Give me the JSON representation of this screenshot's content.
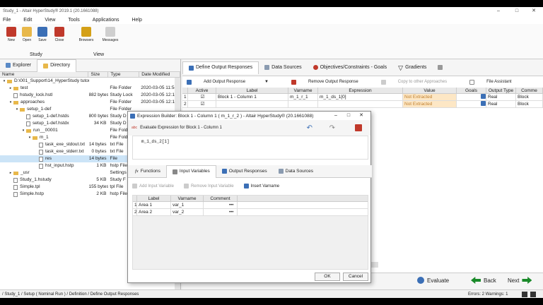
{
  "window": {
    "title": "Study_1 - Altair HyperStudy® 2019.1 (20.1661088)",
    "min": "–",
    "max": "□",
    "close": "✕"
  },
  "menu": [
    "File",
    "Edit",
    "View",
    "Tools",
    "Applications",
    "Help"
  ],
  "ribbon": {
    "study_buttons": [
      "New",
      "Open",
      "Save",
      "Close"
    ],
    "study_group": "Study",
    "view_buttons": [
      "Browsers",
      "Messages"
    ],
    "view_group": "View"
  },
  "left_tabs": [
    "Explorer",
    "Directory"
  ],
  "tree_columns": [
    "Name",
    "Size",
    "Type",
    "Date Modified"
  ],
  "tree": [
    {
      "name": "D:\\001_Support\\14_HyperStudy tutorials_recording\\HS-1010_Set Up a Simple Stu...",
      "size": "",
      "type": "",
      "date": "",
      "kind": "folder",
      "indent": 0,
      "arrow": "▾"
    },
    {
      "name": "test",
      "size": "",
      "type": "File Folder",
      "date": "2020-03-05 11:54",
      "kind": "folder",
      "indent": 1,
      "arrow": "▸"
    },
    {
      "name": "hstudy_lock.hstl",
      "size": "882 bytes",
      "type": "Study Lock",
      "date": "2020-03-05 12:14",
      "kind": "file",
      "indent": 1,
      "arrow": ""
    },
    {
      "name": "approaches",
      "size": "",
      "type": "File Folder",
      "date": "2020-03-05 12:11",
      "kind": "folder",
      "indent": 1,
      "arrow": "▾"
    },
    {
      "name": "setup_1-def",
      "size": "",
      "type": "File Folder",
      "date": "",
      "kind": "folder",
      "indent": 2,
      "arrow": "▾"
    },
    {
      "name": "setup_1-def.hstds",
      "size": "800 bytes",
      "type": "Study D",
      "date": "",
      "kind": "file",
      "indent": 3,
      "arrow": ""
    },
    {
      "name": "setup_1-def.hstdx",
      "size": "34 KB",
      "type": "Study D",
      "date": "",
      "kind": "file",
      "indent": 3,
      "arrow": ""
    },
    {
      "name": "run__00001",
      "size": "",
      "type": "File Fold",
      "date": "",
      "kind": "folder",
      "indent": 3,
      "arrow": "▾"
    },
    {
      "name": "m_1",
      "size": "",
      "type": "File Fold",
      "date": "",
      "kind": "folder",
      "indent": 4,
      "arrow": "▾"
    },
    {
      "name": "task_exe_stdout.txt",
      "size": "14 bytes",
      "type": "txt File",
      "date": "",
      "kind": "file",
      "indent": 5,
      "arrow": ""
    },
    {
      "name": "task_exe_stderr.txt",
      "size": "0 bytes",
      "type": "txt File",
      "date": "",
      "kind": "file",
      "indent": 5,
      "arrow": ""
    },
    {
      "name": "res",
      "size": "14 bytes",
      "type": "File",
      "date": "",
      "kind": "file",
      "indent": 5,
      "arrow": "",
      "selected": true
    },
    {
      "name": "hst_input.hstp",
      "size": "1 KB",
      "type": "hstp File",
      "date": "",
      "kind": "file",
      "indent": 5,
      "arrow": ""
    },
    {
      "name": "_usr",
      "size": "",
      "type": "Settings",
      "date": "",
      "kind": "folder",
      "indent": 1,
      "arrow": "▸"
    },
    {
      "name": "Study_1.hstudy",
      "size": "5 KB",
      "type": "Study F",
      "date": "",
      "kind": "file",
      "indent": 1,
      "arrow": ""
    },
    {
      "name": "Simple.tpl",
      "size": "155 bytes",
      "type": "tpl File",
      "date": "",
      "kind": "file",
      "indent": 1,
      "arrow": ""
    },
    {
      "name": "Simple.hstp",
      "size": "2 KB",
      "type": "hstp File",
      "date": "",
      "kind": "file",
      "indent": 1,
      "arrow": ""
    }
  ],
  "right_tabs": [
    "Define Output Responses",
    "Data Sources",
    "Objectives/Constraints - Goals",
    "Gradients"
  ],
  "toolbar": {
    "add": "Add Output Response",
    "remove": "Remove Output Response",
    "copy": "Copy to other Approaches",
    "file_assistant": "File Assistant"
  },
  "grid_columns": [
    "",
    "Active",
    "Label",
    "Varname",
    "Expression",
    "Value",
    "Goals",
    "Output Type",
    "Comme"
  ],
  "grid_rows": [
    {
      "n": "1",
      "label": "Block 1 - Column 1",
      "varname": "m_1_r_1",
      "expr": "m_1_ds_1[0]",
      "value": "Not Extracted",
      "type": "Real",
      "comment": "Block"
    },
    {
      "n": "2",
      "label": "",
      "varname": "",
      "expr": "",
      "value": "Not Extracted",
      "type": "Real",
      "comment": "Block"
    }
  ],
  "dialog": {
    "title": "Expression Builder: Block 1 - Column 1 ( m_1_r_2 ) - Altair HyperStudy® (20.1661088)",
    "subtitle": "Evaluate Expression for Block 1 - Column 1",
    "expression": "m_1_ds_2[1]",
    "tabs": [
      "Functions",
      "Input Variables",
      "Output Responses",
      "Data Sources"
    ],
    "tools": {
      "add": "Add Input Variable",
      "remove": "Remove Input Variable",
      "insert": "Insert Varname"
    },
    "columns": [
      "",
      "Label",
      "Varname",
      "Comment"
    ],
    "rows": [
      {
        "n": "1",
        "label": "Area 1",
        "varname": "var_1",
        "comment": ""
      },
      {
        "n": "2",
        "label": "Area 2",
        "varname": "var_2",
        "comment": ""
      }
    ],
    "ok": "OK",
    "cancel": "Cancel"
  },
  "bottom": {
    "evaluate": "Evaluate",
    "back": "Back",
    "next": "Next"
  },
  "status": {
    "path": "/ Study_1 / Setup ( Nominal Run ) / Definition / Define Output Responses",
    "messages": "Errors: 2  Warnings: 1"
  },
  "colors": {
    "accent": "#1a8a2a",
    "selected": "#cce4f7",
    "not_extracted_bg": "#fde7c5",
    "folder": "#e8b84a"
  }
}
